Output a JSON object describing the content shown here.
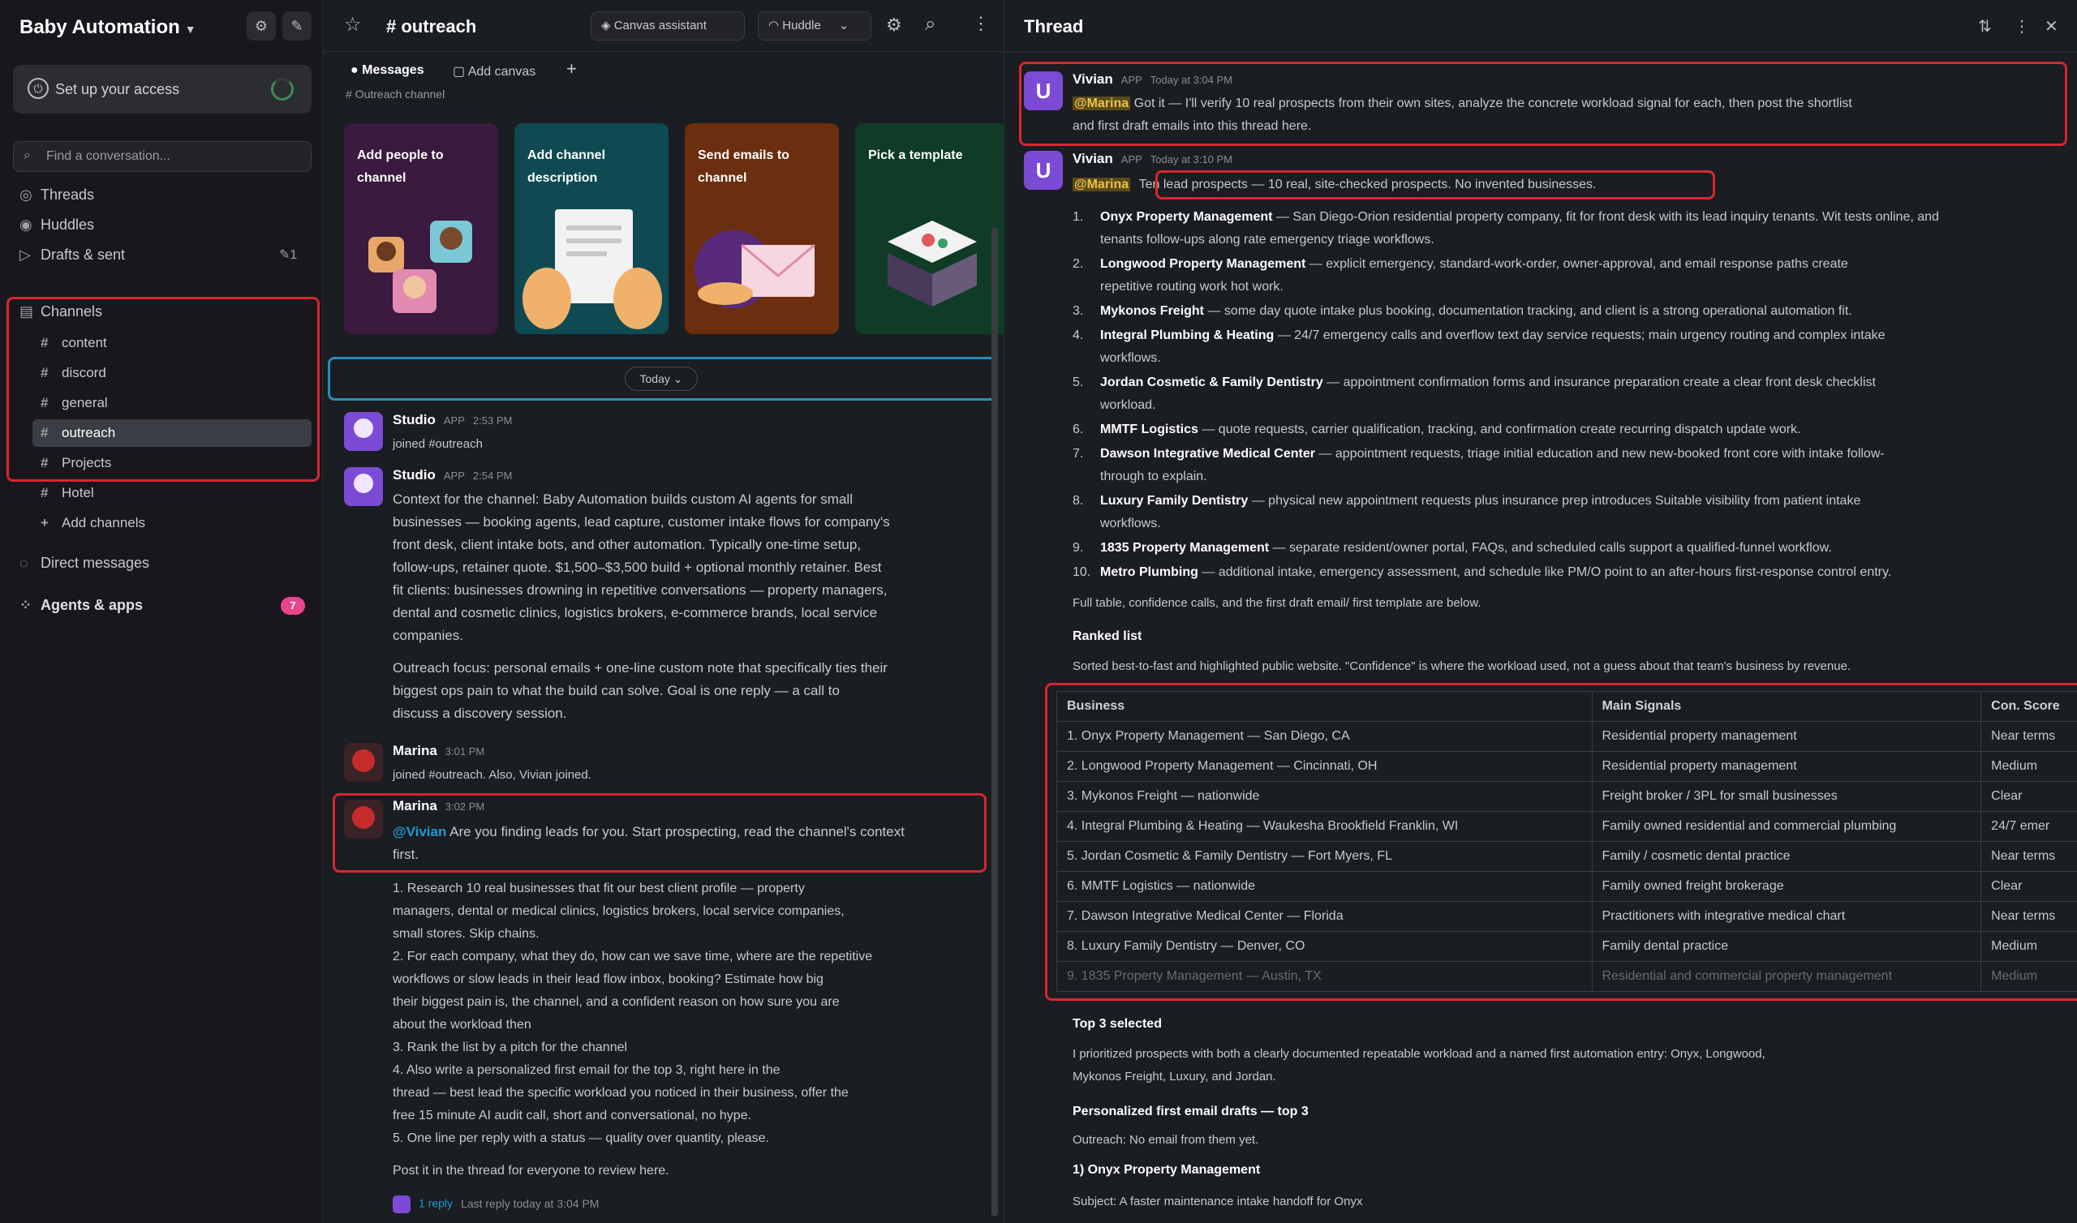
{
  "sidebar": {
    "workspace": "Baby Automation",
    "setup_label": "Set up your access",
    "search_placeholder": "Find a conversation...",
    "nav": [
      {
        "label": "Threads"
      },
      {
        "label": "Huddles"
      },
      {
        "label": "Drafts & sent"
      }
    ],
    "drafts_count": "1",
    "channels_header": "Channels",
    "channels": [
      {
        "name": "content"
      },
      {
        "name": "discord"
      },
      {
        "name": "general"
      },
      {
        "name": "outreach"
      },
      {
        "name": "Projects"
      },
      {
        "name": "Hotel"
      }
    ],
    "add_channels": "Add channels",
    "direct_messages": "Direct messages",
    "agents_apps": "Agents & apps",
    "agents_badge": "7"
  },
  "channel": {
    "name": "outreach",
    "pill_canvas": "Canvas assistant",
    "pill_huddle": "Huddle",
    "tabs": [
      {
        "label": "Messages"
      },
      {
        "label": "Add canvas"
      }
    ],
    "cutoff_text": "# Outreach channel",
    "cards": [
      {
        "label": "Add people to channel",
        "color": "#3a1a3e"
      },
      {
        "label": "Add channel description",
        "color": "#0f4a52"
      },
      {
        "label": "Send emails to channel",
        "color": "#6b2e0e"
      },
      {
        "label": "Pick a template",
        "color": "#0f3b27"
      }
    ],
    "today_label": "Today",
    "messages": [
      {
        "author": "Studio",
        "tag": "APP",
        "time": "2:53 PM",
        "lines": [
          "joined #outreach"
        ]
      },
      {
        "author": "Studio",
        "tag": "APP",
        "time": "2:54 PM",
        "lines": [
          "Context for the channel: Baby Automation builds custom AI agents for small",
          "businesses — booking agents, lead capture, customer intake flows for company's",
          "front desk, client intake bots, and other automation. Typically one-time setup,",
          "follow-ups, retainer quote. $1,500–$3,500 build + optional monthly retainer. Best",
          "fit clients: businesses drowning in repetitive conversations — property managers,",
          "dental and cosmetic clinics, logistics brokers, e-commerce brands, local service",
          "companies."
        ],
        "para2": [
          "Outreach focus: personal emails + one-line custom note that specifically ties their",
          "biggest ops pain to what the build can solve. Goal is one reply — a call to",
          "discuss a discovery session."
        ]
      },
      {
        "author": "Marina",
        "tag": "",
        "time": "3:01 PM",
        "lines": [
          "joined #outreach. Also, Vivian joined."
        ]
      },
      {
        "author": "Marina",
        "tag": "",
        "time": "3:02 PM",
        "mention": "@Vivian",
        "lines": [
          "Are you finding leads for you. Start prospecting, read the channel's context",
          "first."
        ]
      }
    ],
    "list_items": [
      "1. Research 10 real businesses that fit our best client profile — property",
      "managers, dental or medical clinics, logistics brokers, local service companies,",
      "small stores. Skip chains.",
      "2. For each company, what they do, how can we save time, where are the repetitive",
      "workflows or slow leads in their lead flow inbox, booking? Estimate how big",
      "their biggest pain is, the channel, and a confident reason on how sure you are",
      "about the workload then",
      "3. Rank the list by a pitch for the channel",
      "4. Also write a personalized first email for the top 3, right here in the",
      "thread — best lead the specific workload you noticed in their business, offer the",
      "free 15 minute AI audit call, short and conversational, no hype.",
      "5. One line per reply with a status — quality over quantity, please."
    ],
    "final_line": "Post it in the thread for everyone to review here.",
    "thread_reply": "1 reply",
    "thread_reply_meta": "Last reply today at 3:04 PM"
  },
  "thread": {
    "title": "Thread",
    "msg1": {
      "author": "Vivian",
      "tag": "APP",
      "time": "Today at 3:04 PM",
      "mention": "@Marina",
      "text1": "Got it — I'll verify 10 real prospects from their own sites, analyze the concrete workload signal for each, then post the shortlist",
      "text2": "and first draft emails into this thread here."
    },
    "msg2": {
      "author": "Vivian",
      "tag": "APP",
      "time": "Today at 3:10 PM",
      "mention": "@Marina",
      "headline": "Ten lead prospects — 10 real, site-checked prospects. No invented businesses."
    },
    "prospects": [
      {
        "name": "Onyx Property Management",
        "desc": "— San Diego-Orion residential property company, fit for front desk with its lead inquiry tenants. Wit tests online, and"
      },
      {
        "name": "",
        "desc": "tenants follow-ups along rate emergency triage workflows."
      },
      {
        "name": "Longwood Property Management",
        "desc": "— explicit emergency, standard-work-order, owner-approval, and email response paths create"
      },
      {
        "name": "",
        "desc": "repetitive routing work hot work."
      },
      {
        "name": "Mykonos Freight",
        "desc": "— some day quote intake plus booking, documentation tracking, and client is a strong operational automation fit."
      },
      {
        "name": "Integral Plumbing & Heating",
        "desc": "— 24/7 emergency calls and overflow text day service requests; main urgency routing and complex intake"
      },
      {
        "name": "",
        "desc": "workflows."
      },
      {
        "name": "Jordan Cosmetic & Family Dentistry",
        "desc": "— appointment confirmation forms and insurance preparation create a clear front desk checklist"
      },
      {
        "name": "",
        "desc": "workload."
      },
      {
        "name": "MMTF Logistics",
        "desc": "— quote requests, carrier qualification, tracking, and confirmation create recurring dispatch update work."
      },
      {
        "name": "Dawson Integrative Medical Center",
        "desc": "— appointment requests, triage initial education and new new-booked front core with intake follow-"
      },
      {
        "name": "",
        "desc": "through to explain."
      },
      {
        "name": "Luxury Family Dentistry",
        "desc": "— physical new appointment requests plus insurance prep introduces Suitable visibility from patient intake"
      },
      {
        "name": "",
        "desc": "workflows."
      },
      {
        "name": "1835 Property Management",
        "desc": "— separate resident/owner portal, FAQs, and scheduled calls support a qualified-funnel workflow."
      },
      {
        "name": "Metro Plumbing",
        "desc": "— additional intake, emergency assessment, and schedule like PM/O point to an after-hours first-response control entry."
      }
    ],
    "prospect_numbers": [
      "1.",
      "",
      "2.",
      "",
      "3.",
      "4.",
      "",
      "5.",
      "",
      "6.",
      "7.",
      "",
      "8.",
      "",
      "9.",
      "10."
    ],
    "footnote": "Full table, confidence calls, and the first draft email/ first template are below.",
    "ranked_label": "Ranked list",
    "ranked_desc": "Sorted best-to-fast and highlighted public website. \"Confidence\" is where the workload used, not a guess about that team's business by revenue.",
    "table": {
      "headers": [
        "Business",
        "Main Signals",
        "Con. Score"
      ],
      "rows": [
        [
          "1. Onyx Property Management — San Diego, CA",
          "Residential property management",
          "Near terms"
        ],
        [
          "2. Longwood Property Management — Cincinnati, OH",
          "Residential property management",
          "Medium"
        ],
        [
          "3. Mykonos Freight — nationwide",
          "Freight broker / 3PL for small businesses",
          "Clear"
        ],
        [
          "4. Integral Plumbing & Heating — Waukesha Brookfield Franklin, WI",
          "Family owned residential and commercial plumbing",
          "24/7 emer"
        ],
        [
          "5. Jordan Cosmetic & Family Dentistry — Fort Myers, FL",
          "Family / cosmetic dental practice",
          "Near terms"
        ],
        [
          "6. MMTF Logistics — nationwide",
          "Family owned freight brokerage",
          "Clear"
        ],
        [
          "7. Dawson Integrative Medical Center — Florida",
          "Practitioners with integrative medical chart",
          "Near terms"
        ],
        [
          "8. Luxury Family Dentistry — Denver, CO",
          "Family dental practice",
          "Medium"
        ],
        [
          "9. 1835 Property Management — Austin, TX",
          "Residential and commercial property management",
          "Medium"
        ]
      ]
    },
    "top3_label": "Top 3 selected",
    "top3_text": "I prioritized prospects with both a clearly documented repeatable workload and a named first automation entry: Onyx, Longwood,",
    "top3_text2": "Mykonos Freight, Luxury, and Jordan.",
    "draft_label": "Personalized first email drafts — top 3",
    "draft_sub": "Outreach: No email from them yet.",
    "draft_item": "1) Onyx Property Management",
    "draft_subject": "Subject: A faster maintenance intake handoff for Onyx"
  }
}
